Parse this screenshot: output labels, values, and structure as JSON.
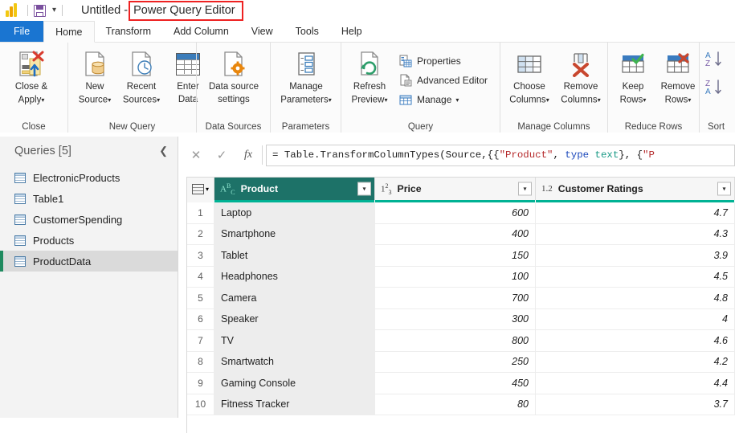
{
  "titlebar": {
    "logo_icon": "power-bi-logo",
    "save_icon": "save-icon",
    "qat_dropdown_icon": "chevron-down-icon",
    "document_name": "Untitled",
    "separator": "-",
    "app_name": "Power Query Editor",
    "annotation_color": "#ee2222"
  },
  "tabs": [
    {
      "label": "File",
      "state": "file"
    },
    {
      "label": "Home",
      "state": "active"
    },
    {
      "label": "Transform",
      "state": "normal"
    },
    {
      "label": "Add Column",
      "state": "normal"
    },
    {
      "label": "View",
      "state": "normal"
    },
    {
      "label": "Tools",
      "state": "normal"
    },
    {
      "label": "Help",
      "state": "normal"
    }
  ],
  "ribbon": {
    "groups": [
      {
        "label": "Close",
        "items": [
          {
            "name": "close-and-apply",
            "line1": "Close &",
            "line2": "Apply",
            "caret": "▾",
            "icon": "close-apply-icon"
          }
        ]
      },
      {
        "label": "New Query",
        "items": [
          {
            "name": "new-source",
            "line1": "New",
            "line2": "Source",
            "caret": "▾",
            "icon": "new-source-icon"
          },
          {
            "name": "recent-sources",
            "line1": "Recent",
            "line2": "Sources",
            "caret": "▾",
            "icon": "recent-sources-icon"
          },
          {
            "name": "enter-data",
            "line1": "Enter",
            "line2": "Data",
            "caret": "",
            "icon": "enter-data-icon"
          }
        ]
      },
      {
        "label": "Data Sources",
        "items": [
          {
            "name": "data-source-settings",
            "line1": "Data source",
            "line2": "settings",
            "caret": "",
            "icon": "data-source-settings-icon"
          }
        ]
      },
      {
        "label": "Parameters",
        "items": [
          {
            "name": "manage-parameters",
            "line1": "Manage",
            "line2": "Parameters",
            "caret": "▾",
            "icon": "manage-parameters-icon"
          }
        ]
      },
      {
        "label": "Query",
        "items": [
          {
            "name": "refresh-preview",
            "line1": "Refresh",
            "line2": "Preview",
            "caret": "▾",
            "icon": "refresh-preview-icon"
          }
        ],
        "small_items": [
          {
            "name": "properties",
            "label": "Properties",
            "caret": "",
            "icon": "properties-icon"
          },
          {
            "name": "advanced-editor",
            "label": "Advanced Editor",
            "caret": "",
            "icon": "advanced-editor-icon"
          },
          {
            "name": "manage",
            "label": "Manage",
            "caret": "▾",
            "icon": "manage-icon"
          }
        ]
      },
      {
        "label": "Manage Columns",
        "items": [
          {
            "name": "choose-columns",
            "line1": "Choose",
            "line2": "Columns",
            "caret": "▾",
            "icon": "choose-columns-icon"
          },
          {
            "name": "remove-columns",
            "line1": "Remove",
            "line2": "Columns",
            "caret": "▾",
            "icon": "remove-columns-icon"
          }
        ]
      },
      {
        "label": "Reduce Rows",
        "items": [
          {
            "name": "keep-rows",
            "line1": "Keep",
            "line2": "Rows",
            "caret": "▾",
            "icon": "keep-rows-icon"
          },
          {
            "name": "remove-rows",
            "line1": "Remove",
            "line2": "Rows",
            "caret": "▾",
            "icon": "remove-rows-icon"
          }
        ]
      },
      {
        "label": "Sort",
        "items": [
          {
            "name": "sort-ascending",
            "label": "A↓",
            "icon": "sort-az-icon"
          },
          {
            "name": "sort-descending",
            "label": "Z↓",
            "icon": "sort-za-icon"
          }
        ]
      }
    ]
  },
  "queries_pane": {
    "title": "Queries [5]",
    "collapse_icon": "chevron-left-icon",
    "items": [
      {
        "label": "ElectronicProducts",
        "selected": false,
        "icon": "table-icon"
      },
      {
        "label": "Table1",
        "selected": false,
        "icon": "table-icon"
      },
      {
        "label": "CustomerSpending",
        "selected": false,
        "icon": "table-icon"
      },
      {
        "label": "Products",
        "selected": false,
        "icon": "table-icon"
      },
      {
        "label": "ProductData",
        "selected": true,
        "icon": "table-icon"
      }
    ]
  },
  "formula_bar": {
    "cancel_icon": "close-icon",
    "accept_icon": "check-icon",
    "fx_label": "fx",
    "formula_plain": "= Table.TransformColumnTypes(Source,{{\"Product\", type text}, {\"P",
    "tokens": [
      {
        "t": "= Table.TransformColumnTypes(Source,{{",
        "k": "plain"
      },
      {
        "t": "\"Product\"",
        "k": "string"
      },
      {
        "t": ", ",
        "k": "plain"
      },
      {
        "t": "type",
        "k": "keyword"
      },
      {
        "t": " ",
        "k": "plain"
      },
      {
        "t": "text",
        "k": "type"
      },
      {
        "t": "}, {",
        "k": "plain"
      },
      {
        "t": "\"P",
        "k": "string"
      }
    ]
  },
  "grid": {
    "corner_icon": "select-all-icon",
    "dropdown_icon": "filter-dropdown-icon",
    "selected_column": "Product",
    "selected_header_color": "#1d7268",
    "quality_bar_color": "#00b294",
    "columns": [
      {
        "name": "Product",
        "type_icon": "ABC",
        "type": "text",
        "align": "left",
        "selected": true
      },
      {
        "name": "Price",
        "type_icon": "123",
        "type": "whole number",
        "align": "right",
        "selected": false
      },
      {
        "name": "Customer Ratings",
        "type_icon": "1.2",
        "type": "decimal",
        "align": "right",
        "selected": false
      }
    ],
    "rows": [
      {
        "index": "1",
        "Product": "Laptop",
        "Price": "600",
        "Customer Ratings": "4.7"
      },
      {
        "index": "2",
        "Product": "Smartphone",
        "Price": "400",
        "Customer Ratings": "4.3"
      },
      {
        "index": "3",
        "Product": "Tablet",
        "Price": "150",
        "Customer Ratings": "3.9"
      },
      {
        "index": "4",
        "Product": "Headphones",
        "Price": "100",
        "Customer Ratings": "4.5"
      },
      {
        "index": "5",
        "Product": "Camera",
        "Price": "700",
        "Customer Ratings": "4.8"
      },
      {
        "index": "6",
        "Product": "Speaker",
        "Price": "300",
        "Customer Ratings": "4"
      },
      {
        "index": "7",
        "Product": "TV",
        "Price": "800",
        "Customer Ratings": "4.6"
      },
      {
        "index": "8",
        "Product": "Smartwatch",
        "Price": "250",
        "Customer Ratings": "4.2"
      },
      {
        "index": "9",
        "Product": "Gaming Console",
        "Price": "450",
        "Customer Ratings": "4.4"
      },
      {
        "index": "10",
        "Product": "Fitness Tracker",
        "Price": "80",
        "Customer Ratings": "3.7"
      }
    ]
  }
}
